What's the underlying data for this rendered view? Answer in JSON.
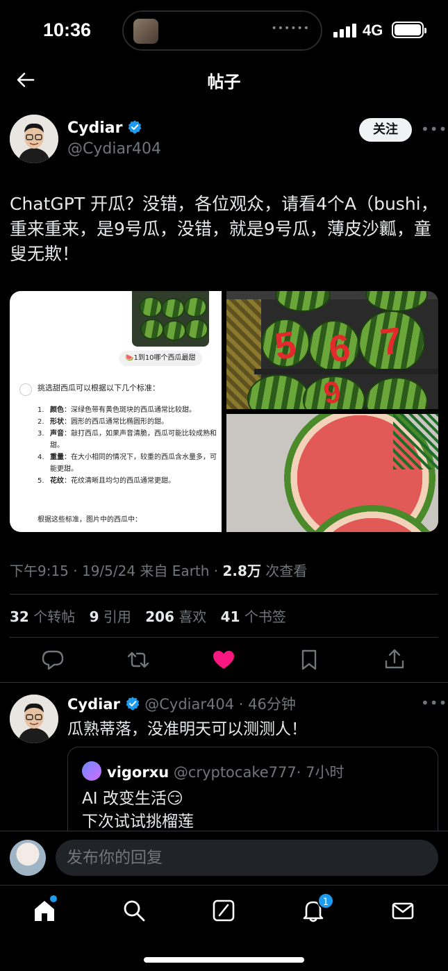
{
  "status_bar": {
    "time": "10:36",
    "network": "4G"
  },
  "header": {
    "title": "帖子"
  },
  "post": {
    "author_name": "Cydiar",
    "author_handle": "@Cydiar404",
    "follow_label": "关注",
    "text": "ChatGPT 开瓜？没错，各位观众，请看4个A（bushi，重来重来，是9号瓜，没错，就是9号瓜，薄皮沙瓤，童叟无欺！",
    "media": {
      "chat_pill": "🍉1到10哪个西瓜最甜",
      "chat_intro": "挑选甜西瓜可以根据以下几个标准：",
      "chat_items": [
        {
          "num": "1.",
          "term": "颜色",
          "desc": "：深绿色带有黄色斑块的西瓜通常比较甜。"
        },
        {
          "num": "2.",
          "term": "形状",
          "desc": "：圆形的西瓜通常比椭圆形的甜。"
        },
        {
          "num": "3.",
          "term": "声音",
          "desc": "：敲打西瓜，如果声音清脆，西瓜可能比较成熟和甜。"
        },
        {
          "num": "4.",
          "term": "重量",
          "desc": "：在大小相同的情况下，较重的西瓜含水量多，可能更甜。"
        },
        {
          "num": "5.",
          "term": "花纹",
          "desc": "：花纹清晰且均匀的西瓜通常更甜。"
        }
      ],
      "chat_end": "根据这些标准，图片中的西瓜中：",
      "photo_digits": [
        "5",
        "6",
        "7",
        "9"
      ]
    },
    "meta_time": "下午9:15 · 19/5/24 来自 Earth · ",
    "meta_views": "2.8万",
    "meta_views_label": " 次查看",
    "stats": {
      "reposts": "32",
      "reposts_label": "个转帖",
      "quotes": "9",
      "quotes_label": "引用",
      "likes": "206",
      "likes_label": "喜欢",
      "bookmarks": "41",
      "bookmarks_label": "个书签"
    }
  },
  "reply": {
    "author_name": "Cydiar",
    "author_handle": "@Cydiar404",
    "time": "· 46分钟",
    "text": "瓜熟蒂落，没准明天可以测测人！",
    "quote": {
      "author_name": "vigorxu",
      "author_handle": "@cryptocake777",
      "time": "· 7小时",
      "line1": "AI 改变生活😏",
      "line2": "下次试试挑榴莲"
    }
  },
  "composer": {
    "placeholder": "发布你的回复"
  },
  "tabbar": {
    "notifications_badge": "1"
  },
  "colors": {
    "background": "#000000",
    "accent": "#1d9bf0",
    "like": "#f91880",
    "muted": "#71767b"
  }
}
